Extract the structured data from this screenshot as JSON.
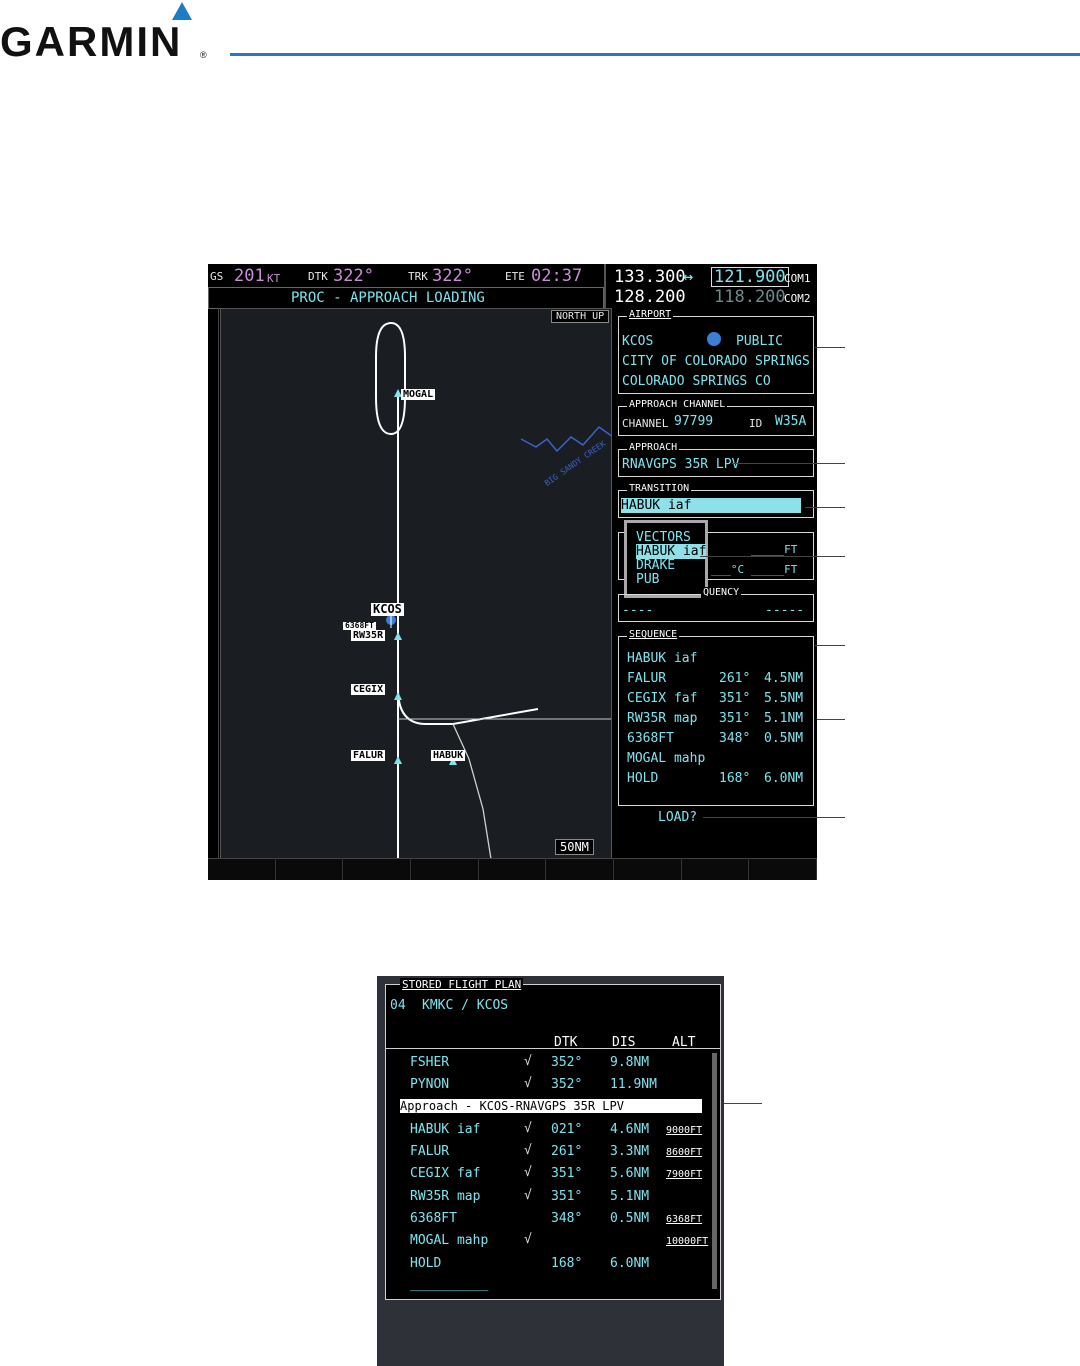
{
  "brand": {
    "name": "GARMIN",
    "reg": "®",
    "accent": "#2a78c2"
  },
  "header": {
    "gs_label": "GS",
    "gs_value": "201",
    "gs_unit": "KT",
    "dtk_label": "DTK",
    "dtk_value": "322°",
    "trk_label": "TRK",
    "trk_value": "322°",
    "ete_label": "ETE",
    "ete_value": "02:37",
    "page_title": "PROC - APPROACH LOADING"
  },
  "radios": {
    "com1_active": "133.300",
    "swap": "↔",
    "com1_standby": "121.900",
    "com1_label": "COM1",
    "com2_active": "128.200",
    "com2_standby": "118.200",
    "com2_label": "COM2"
  },
  "map": {
    "orientation": "NORTH UP",
    "range": "50NM",
    "waypoints": [
      "MOGAL",
      "KCOS",
      "6368FT",
      "RW35R",
      "CEGIX",
      "FALUR",
      "HABUK"
    ],
    "river_label": "BIG SANDY CREEK"
  },
  "airport": {
    "title": "AIRPORT",
    "ident": "KCOS",
    "type": "PUBLIC",
    "city": "CITY OF COLORADO SPRINGS",
    "location": "COLORADO SPRINGS CO"
  },
  "approach_channel": {
    "title": "APPROACH CHANNEL",
    "channel_label": "CHANNEL",
    "channel": "97799",
    "id_label": "ID",
    "id": "W35A"
  },
  "approach": {
    "title": "APPROACH",
    "name": "RNAVGPS 35R LPV"
  },
  "transition": {
    "title": "TRANSITION",
    "selected": "HABUK iaf"
  },
  "transition_list": [
    "VECTORS",
    "HABUK iaf",
    "DRAKE",
    "PUB"
  ],
  "minimums": {
    "ft1": "_____FT",
    "temp": "___°C",
    "ft2": "_____FT"
  },
  "frequency": {
    "title": "QUENCY",
    "left": "----",
    "right": "-----"
  },
  "sequence": {
    "title": "SEQUENCE",
    "rows": [
      {
        "wpt": "HABUK iaf",
        "dtk": "",
        "dis": ""
      },
      {
        "wpt": "FALUR",
        "dtk": "261°",
        "dis": "4.5NM"
      },
      {
        "wpt": "CEGIX faf",
        "dtk": "351°",
        "dis": "5.5NM"
      },
      {
        "wpt": "RW35R map",
        "dtk": "351°",
        "dis": "5.1NM"
      },
      {
        "wpt": "6368FT",
        "dtk": "348°",
        "dis": "0.5NM"
      },
      {
        "wpt": "MOGAL mahp",
        "dtk": "",
        "dis": ""
      },
      {
        "wpt": "HOLD",
        "dtk": "168°",
        "dis": "6.0NM"
      }
    ]
  },
  "load_prompt": "LOAD?",
  "stored_plan": {
    "title": "STORED FLIGHT PLAN",
    "number": "04",
    "route": "KMKC / KCOS",
    "col_dtk": "DTK",
    "col_dis": "DIS",
    "col_alt": "ALT",
    "approach_header": "Approach - KCOS-RNAVGPS 35R LPV",
    "rows": [
      {
        "wpt": "FSHER",
        "dtk": "352°",
        "dis": "9.8NM",
        "alt": ""
      },
      {
        "wpt": "PYNON",
        "dtk": "352°",
        "dis": "11.9NM",
        "alt": ""
      },
      {
        "wpt": "HABUK iaf",
        "dtk": "021°",
        "dis": "4.6NM",
        "alt": "9000FT"
      },
      {
        "wpt": "FALUR",
        "dtk": "261°",
        "dis": "3.3NM",
        "alt": "8600FT"
      },
      {
        "wpt": "CEGIX faf",
        "dtk": "351°",
        "dis": "5.6NM",
        "alt": "7900FT"
      },
      {
        "wpt": "RW35R map",
        "dtk": "351°",
        "dis": "5.1NM",
        "alt": ""
      },
      {
        "wpt": "6368FT",
        "dtk": "348°",
        "dis": "0.5NM",
        "alt": "6368FT"
      },
      {
        "wpt": "MOGAL mahp",
        "dtk": "",
        "dis": "",
        "alt": "10000FT"
      },
      {
        "wpt": "HOLD",
        "dtk": "168°",
        "dis": "6.0NM",
        "alt": ""
      }
    ],
    "blank_row": "__________"
  }
}
